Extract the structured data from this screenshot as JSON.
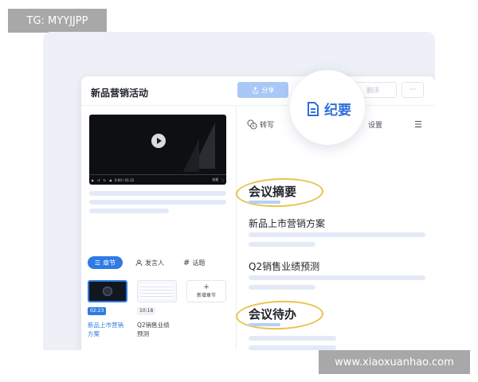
{
  "watermarks": {
    "top_left": "TG: MYYJJPP",
    "bottom_right": "www.xiaoxuanhao.com"
  },
  "window": {
    "title": "新品营销活动",
    "share_label": "分享",
    "share_icon": "share-icon",
    "ghost_label": "翻译",
    "more_label": "···"
  },
  "video": {
    "time_text": "0:00 / 41:32",
    "speed_label": "倍速"
  },
  "left_tabs": [
    {
      "icon": "chapters-icon",
      "label": "章节"
    },
    {
      "icon": "user-icon",
      "label": "发言人"
    },
    {
      "icon": "hash-icon",
      "label": "话题"
    }
  ],
  "chapters": [
    {
      "time": "02:23",
      "title_line1": "新品上市营销",
      "title_line2": "方案"
    },
    {
      "time": "10:18",
      "title_line1": "Q2销售业绩",
      "title_line2": "预测"
    }
  ],
  "add_chapter": {
    "plus": "+",
    "label": "新增章节"
  },
  "right_toolbar": {
    "transcribe_label": "转写",
    "settings_label": "设置",
    "menu_icon": "list-menu-icon"
  },
  "minutes_badge": {
    "icon": "document-icon",
    "label": "纪要"
  },
  "summary": {
    "heading": "会议摘要",
    "item1": "新品上市营销方案",
    "item2": "Q2销售业绩预测"
  },
  "todo": {
    "heading": "会议待办"
  },
  "colors": {
    "accent": "#2f7ae5",
    "highlight_ring": "#e8c34a",
    "skeleton": "#e3eaf6"
  }
}
